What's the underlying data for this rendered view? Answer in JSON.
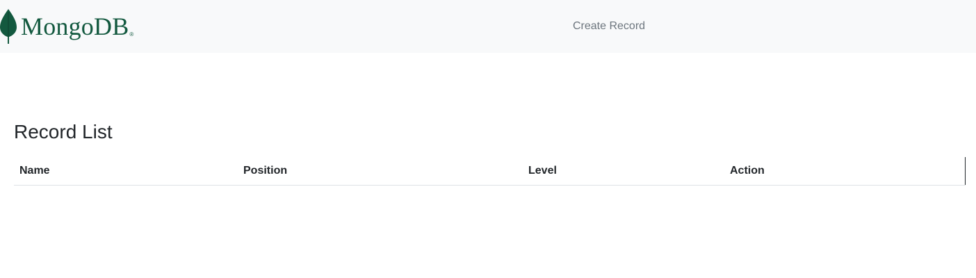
{
  "navbar": {
    "brand_name": "MongoDB",
    "brand_mark": "®",
    "create_link": "Create Record"
  },
  "main": {
    "title": "Record List",
    "table": {
      "columns": [
        "Name",
        "Position",
        "Level",
        "Action"
      ],
      "rows": []
    }
  },
  "colors": {
    "brand": "#13593f",
    "navbar_bg": "#f8f9fa",
    "nav_link": "#6c757d"
  }
}
